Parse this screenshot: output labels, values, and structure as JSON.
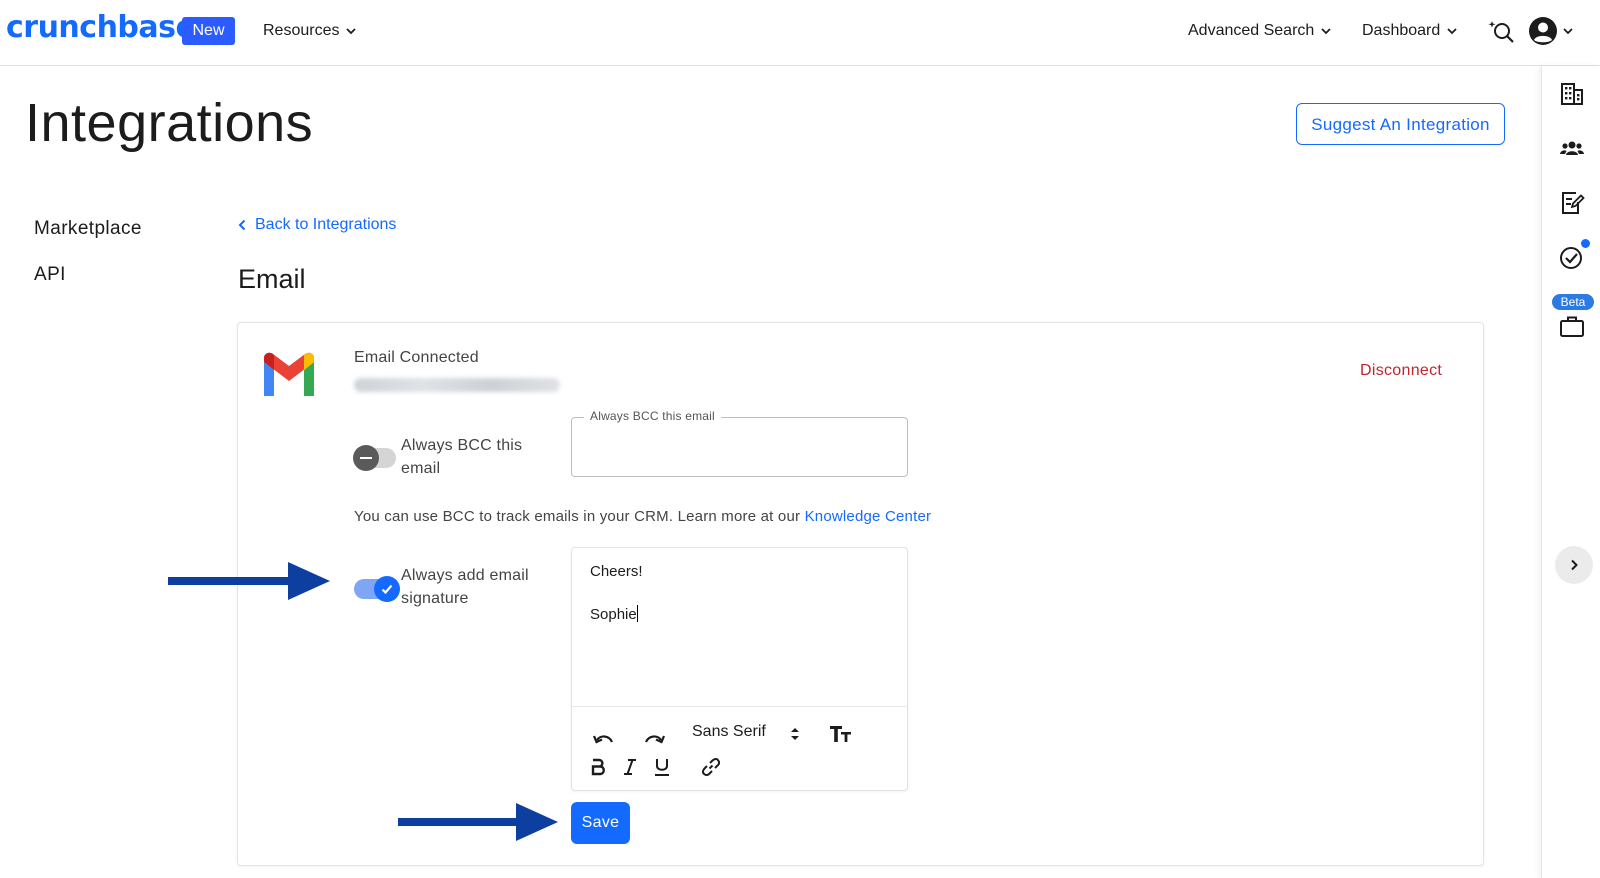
{
  "nav": {
    "logo": "crunchbase",
    "new_badge": "New",
    "resources": "Resources",
    "advanced_search": "Advanced Search",
    "dashboard": "Dashboard"
  },
  "page": {
    "title": "Integrations",
    "suggest_button": "Suggest An Integration"
  },
  "sidebar": {
    "items": [
      {
        "label": "Marketplace"
      },
      {
        "label": "API"
      }
    ]
  },
  "back_link": "Back to Integrations",
  "section_title": "Email",
  "card": {
    "status": "Email Connected",
    "disconnect": "Disconnect",
    "bcc_toggle_label": "Always BCC this email",
    "bcc_field_label": "Always BCC this email",
    "bcc_field_value": "",
    "bcc_help_text": "You can use BCC to track emails in your CRM. Learn more at our ",
    "bcc_help_link": "Knowledge Center",
    "signature_toggle_label": "Always add email signature",
    "signature_lines": [
      "Cheers!",
      "Sophie"
    ],
    "font_select": "Sans Serif",
    "save_button": "Save"
  },
  "toggles": {
    "bcc": false,
    "signature": true
  },
  "rail": {
    "beta_badge": "Beta"
  },
  "colors": {
    "brand": "#146aff",
    "disconnect": "#c0262d",
    "annotation_arrow": "#0d3fa0"
  },
  "icons": [
    "search-icon",
    "account-icon",
    "building-icon",
    "people-icon",
    "notes-icon",
    "check-circle-icon",
    "briefcase-icon",
    "chevron-right-icon",
    "undo-icon",
    "redo-icon",
    "text-size-icon",
    "bold-icon",
    "italic-icon",
    "underline-icon",
    "link-icon",
    "gmail-logo"
  ]
}
